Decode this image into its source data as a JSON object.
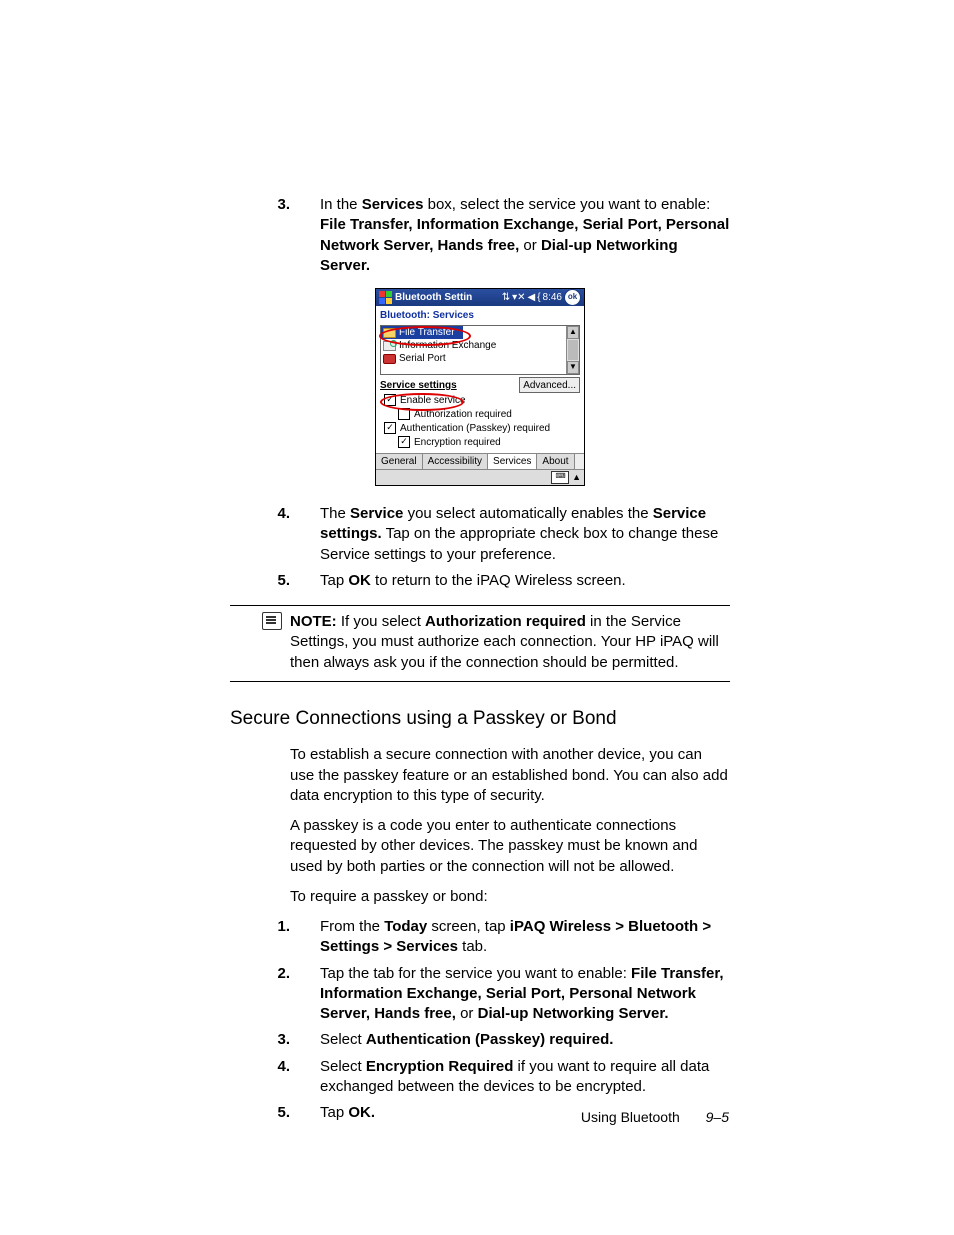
{
  "step3": {
    "num": "3.",
    "pre": "In the ",
    "b1": "Services",
    "mid": " box, select the service you want to enable: ",
    "b2": "File Transfer, Information Exchange, Serial Port, Personal Network Server, Hands free,",
    "post": " or ",
    "b3": "Dial-up Networking Server."
  },
  "step4": {
    "num": "4.",
    "pre": "The ",
    "b1": "Service",
    "mid1": " you select automatically enables the ",
    "b2": "Service settings.",
    "post": " Tap on the appropriate check box to change these Service settings to your preference."
  },
  "step5": {
    "num": "5.",
    "pre": "Tap ",
    "b1": "OK",
    "post": " to return to the iPAQ Wireless screen."
  },
  "note": {
    "label": "NOTE:",
    "pre": "  If you select ",
    "b1": "Authorization required",
    "post": " in the Service Settings, you must authorize each connection. Your HP iPAQ will then always ask you if the connection should be permitted."
  },
  "heading": "Secure Connections using a Passkey or Bond",
  "p1": "To establish a secure connection with another device, you can use the passkey feature or an established bond. You can also add data encryption to this type of security.",
  "p2": "A passkey is a code you enter to authenticate connections requested by other devices. The passkey must be known and used by both parties or the connection will not be allowed.",
  "p3": "To require a passkey or bond:",
  "s1": {
    "num": "1.",
    "pre": "From the ",
    "b1": "Today",
    "mid": " screen, tap ",
    "b2": "iPAQ Wireless > Bluetooth > Settings > Services",
    "post": " tab."
  },
  "s2": {
    "num": "2.",
    "pre": "Tap the tab for the service you want to enable: ",
    "b1": "File Transfer, Information Exchange, Serial Port, Personal Network Server, Hands free,",
    "mid": " or ",
    "b2": "Dial-up Networking Server."
  },
  "s3": {
    "num": "3.",
    "pre": "Select ",
    "b1": "Authentication (Passkey) required."
  },
  "s4": {
    "num": "4.",
    "pre": "Select ",
    "b1": "Encryption Required",
    "post": " if you want to require all data exchanged between the devices to be encrypted."
  },
  "s5": {
    "num": "5.",
    "pre": "Tap ",
    "b1": "OK."
  },
  "footer": {
    "label": "Using Bluetooth",
    "page": "9–5"
  },
  "pda": {
    "title": "Bluetooth Settin",
    "time": "8:46",
    "ok": "ok",
    "subtitle": "Bluetooth: Services",
    "list": {
      "file_transfer": "File Transfer",
      "info_exchange": "Information Exchange",
      "serial_port": "Serial Port"
    },
    "service_settings": "Service settings",
    "advanced": "Advanced...",
    "chk_enable": "Enable service",
    "chk_auth": "Authorization required",
    "chk_passkey": "Authentication (Passkey) required",
    "chk_encrypt": "Encryption required",
    "tabs": {
      "general": "General",
      "accessibility": "Accessibility",
      "services": "Services",
      "about": "About"
    },
    "signals": {
      "conn": "⇅",
      "antenna": "▾✕",
      "vol": "◀",
      "sep": "{"
    }
  }
}
